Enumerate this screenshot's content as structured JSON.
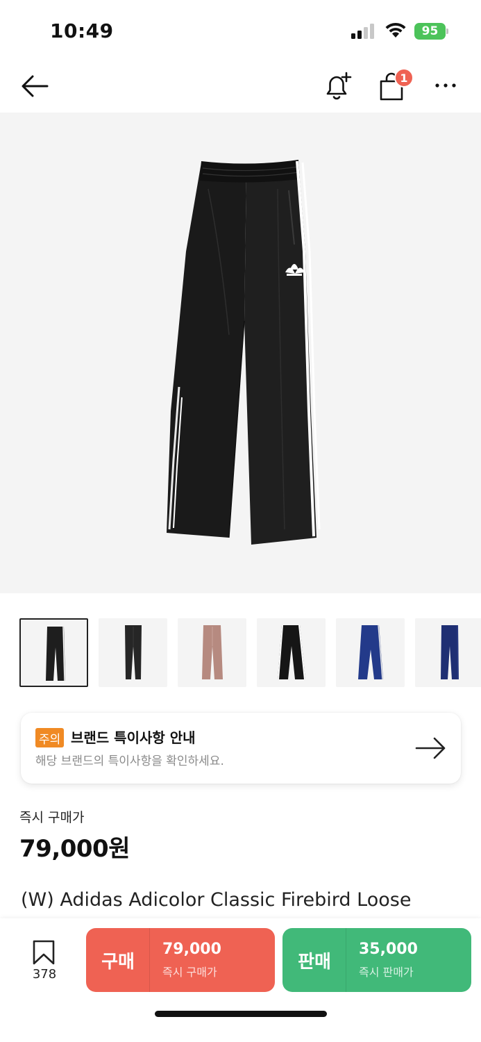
{
  "status_bar": {
    "time": "10:49",
    "battery": "95"
  },
  "nav": {
    "icons": [
      "back-arrow-icon",
      "bell-plus-icon",
      "shopping-bag-icon",
      "more-dots-icon"
    ],
    "cart_count": "1"
  },
  "hero": {
    "image": "black-track-pants-photo"
  },
  "thumbnails": [
    {
      "color": "#1e1e1e",
      "stripe": "#ffffff",
      "selected": true
    },
    {
      "color": "#262626",
      "stripe": "#3a3a3a",
      "selected": false
    },
    {
      "color": "#b68a80",
      "stripe": "#c9a39a",
      "selected": false
    },
    {
      "color": "#161616",
      "stripe": "#ffffff",
      "selected": false
    },
    {
      "color": "#233a8a",
      "stripe": "#e8e8e8",
      "selected": false
    },
    {
      "color": "#1f2f73",
      "stripe": "#2c3d85",
      "selected": false
    }
  ],
  "notice": {
    "badge": "주의",
    "title": "브랜드 특이사항 안내",
    "subtitle": "해당 브랜드의 특이사항을 확인하세요.",
    "badge_color": "#f08a24"
  },
  "price": {
    "label": "즉시 구매가",
    "value": "79,000원"
  },
  "product": {
    "name": "(W) Adidas Adicolor Classic Firebird Loose Track Pants Black - KR Sizing"
  },
  "bottom_bar": {
    "wish_count": "378",
    "buy": {
      "label": "구매",
      "price": "79,000",
      "sub": "즉시 구매가",
      "color": "#ef6253"
    },
    "sell": {
      "label": "판매",
      "price": "35,000",
      "sub": "즉시 판매가",
      "color": "#41b979"
    }
  }
}
